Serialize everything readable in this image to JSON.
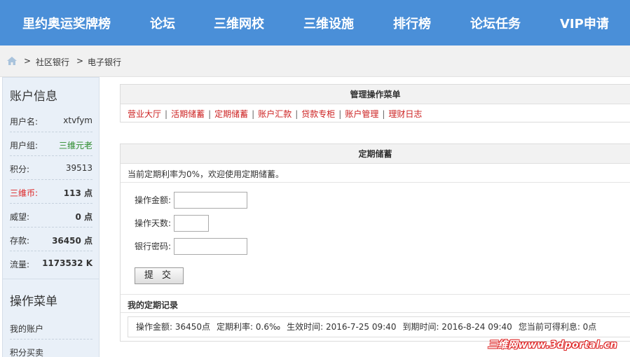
{
  "nav": {
    "items": [
      "里约奥运奖牌榜",
      "论坛",
      "三维网校",
      "三维设施",
      "排行榜",
      "论坛任务",
      "VIP申请"
    ]
  },
  "breadcrumb": {
    "items": [
      "社区银行",
      "电子银行"
    ],
    "separator": ">"
  },
  "sidebar": {
    "account_title": "账户信息",
    "rows": [
      {
        "label": "用户名:",
        "value": "xtvfym"
      },
      {
        "label": "用户组:",
        "value": "三维元老"
      },
      {
        "label": "积分:",
        "value": "39513"
      },
      {
        "label": "三维币:",
        "value": "113 点"
      },
      {
        "label": "威望:",
        "value": "0 点"
      },
      {
        "label": "存款:",
        "value": "36450 点"
      },
      {
        "label": "流量:",
        "value": "1173532 K"
      }
    ],
    "menu_title": "操作菜单",
    "menu_items": [
      "我的账户",
      "积分买卖"
    ]
  },
  "admin_panel": {
    "title": "管理操作菜单",
    "links": [
      "营业大厅",
      "活期储蓄",
      "定期储蓄",
      "账户汇款",
      "贷款专柜",
      "账户管理",
      "理财日志"
    ],
    "separator": "|"
  },
  "deposit_panel": {
    "title": "定期储蓄",
    "notice": "当前定期利率为0%，欢迎使用定期储蓄。",
    "fields": [
      {
        "label": "操作金额:",
        "value": ""
      },
      {
        "label": "操作天数:",
        "value": ""
      },
      {
        "label": "银行密码:",
        "value": ""
      }
    ],
    "submit_label": "提 交",
    "records_title": "我的定期记录",
    "record": {
      "amount": "操作金额: 36450点",
      "rate": "定期利率: 0.6‰",
      "start": "生效时间: 2016-7-25 09:40",
      "end": "到期时间: 2016-8-24 09:40",
      "interest": "您当前可得利息: 0点"
    }
  },
  "watermark": "三维网www.3dportal.cn",
  "colors": {
    "nav_bg": "#4a8fd8",
    "link_red": "#cc1f1f",
    "group_green": "#2a8a2a",
    "sidebar_bg": "#e9f0f8"
  }
}
